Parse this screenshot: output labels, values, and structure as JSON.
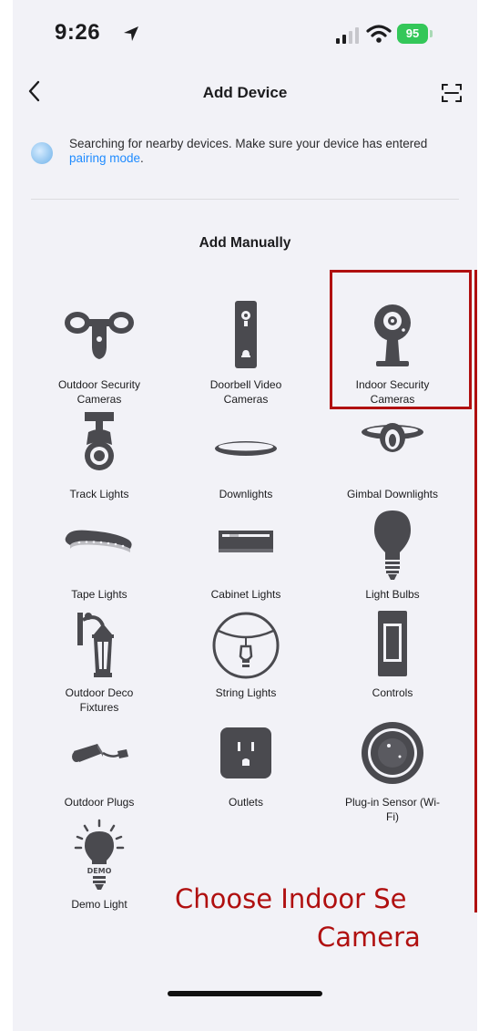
{
  "status_bar": {
    "time": "9:26",
    "battery": "95",
    "icons": [
      "location-arrow-icon",
      "signal-icon",
      "wifi-icon",
      "battery-icon"
    ]
  },
  "nav": {
    "title": "Add Device",
    "icons": [
      "back-chevron-icon",
      "scan-icon"
    ]
  },
  "notice": {
    "text_before": "Searching for nearby devices. Make sure your device has entered ",
    "link": "pairing mode",
    "text_after": "."
  },
  "section": {
    "title": "Add Manually"
  },
  "devices": [
    {
      "label": "Outdoor Security\nCameras",
      "icon": "outdoor-camera-icon"
    },
    {
      "label": "Doorbell Video\nCameras",
      "icon": "doorbell-icon"
    },
    {
      "label": "Indoor Security\nCameras",
      "icon": "indoor-camera-icon"
    },
    {
      "label": "Track Lights",
      "icon": "track-light-icon"
    },
    {
      "label": "Downlights",
      "icon": "downlight-icon"
    },
    {
      "label": "Gimbal Downlights",
      "icon": "gimbal-downlight-icon"
    },
    {
      "label": "Tape Lights",
      "icon": "tape-light-icon"
    },
    {
      "label": "Cabinet Lights",
      "icon": "cabinet-light-icon"
    },
    {
      "label": "Light Bulbs",
      "icon": "light-bulb-icon"
    },
    {
      "label": "Outdoor Deco\nFixtures",
      "icon": "outdoor-fixture-icon"
    },
    {
      "label": "String Lights",
      "icon": "string-light-icon"
    },
    {
      "label": "Controls",
      "icon": "switch-icon"
    },
    {
      "label": "Outdoor Plugs",
      "icon": "outdoor-plug-icon"
    },
    {
      "label": "Outlets",
      "icon": "outlet-icon"
    },
    {
      "label": "Plug-in Sensor (Wi-\nFi)",
      "icon": "sensor-icon"
    },
    {
      "label": "Demo Light",
      "icon": "demo-light-icon"
    }
  ],
  "demo_badge": "DEMO",
  "annotation": {
    "line1": "Choose Indoor Se",
    "line2": "Camera",
    "color": "#b01010"
  }
}
